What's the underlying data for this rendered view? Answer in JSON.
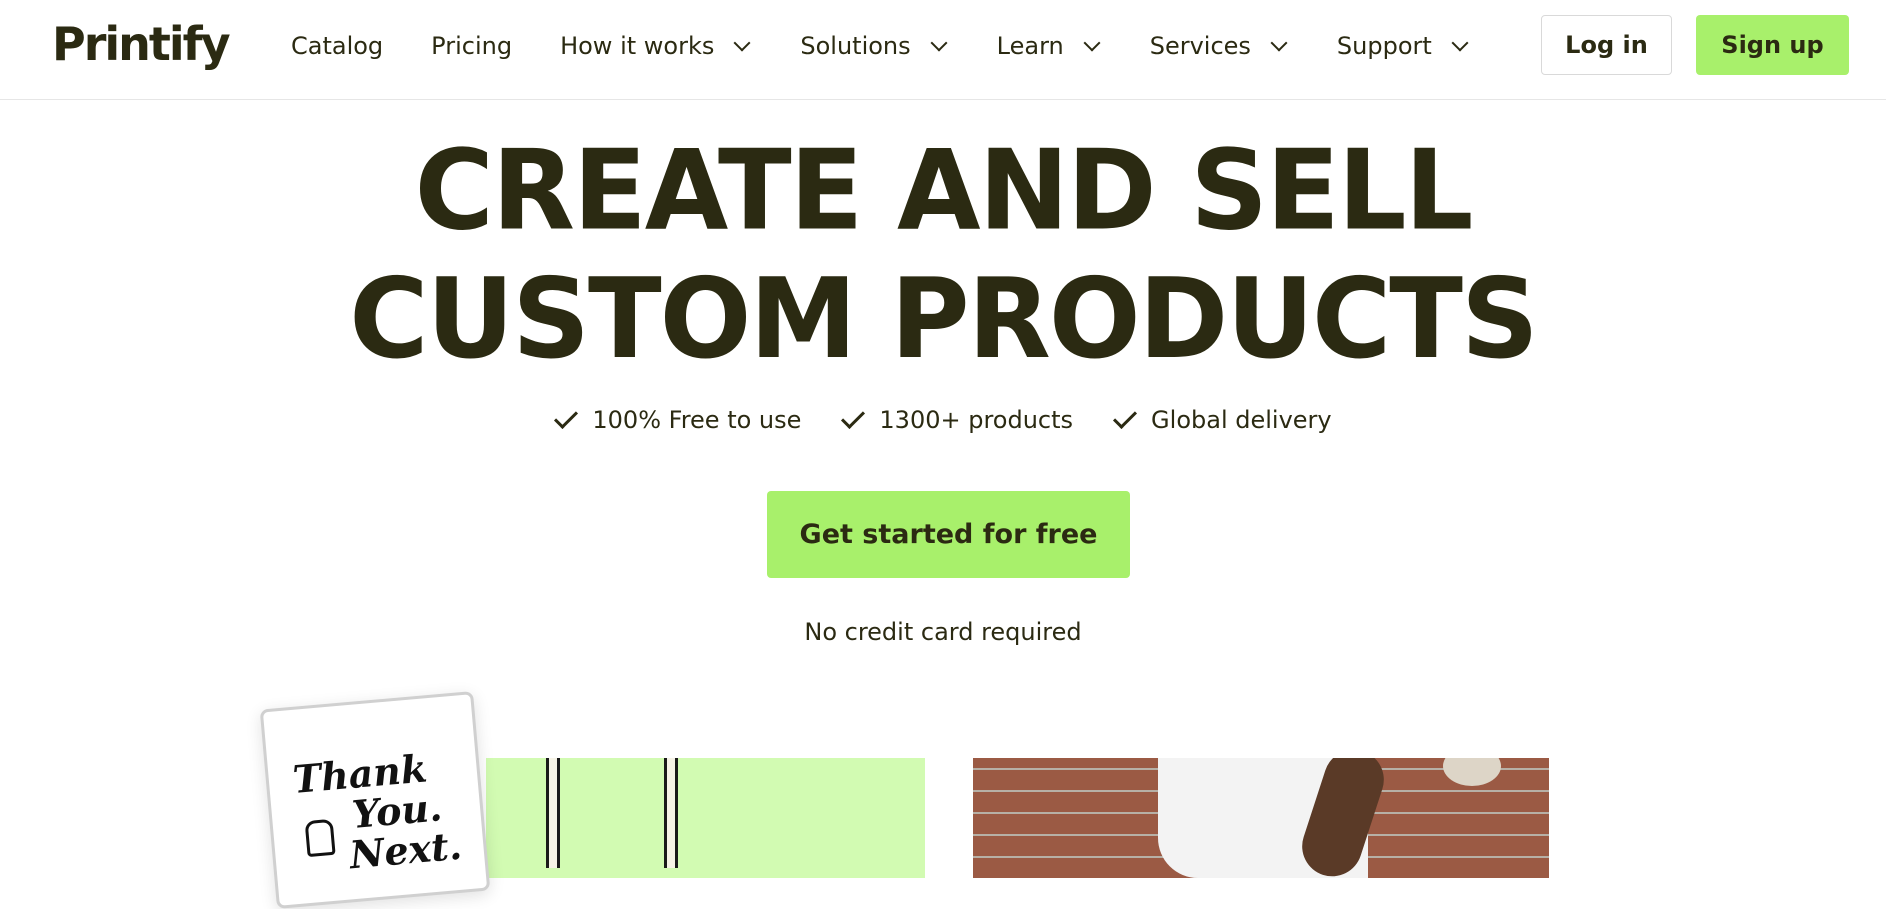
{
  "brand": {
    "logo_text": "Printify",
    "accent": "#a8f06b",
    "text_color": "#2b2a12"
  },
  "nav": {
    "items": [
      {
        "label": "Catalog",
        "has_dropdown": false
      },
      {
        "label": "Pricing",
        "has_dropdown": false
      },
      {
        "label": "How it works",
        "has_dropdown": true
      },
      {
        "label": "Solutions",
        "has_dropdown": true
      },
      {
        "label": "Learn",
        "has_dropdown": true
      },
      {
        "label": "Services",
        "has_dropdown": true
      },
      {
        "label": "Support",
        "has_dropdown": true
      }
    ],
    "login_label": "Log in",
    "signup_label": "Sign up"
  },
  "hero": {
    "title_line1": "CREATE AND SELL",
    "title_line2": "CUSTOM PRODUCTS",
    "features": [
      "100% Free to use",
      "1300+ products",
      "Global delivery"
    ],
    "cta_label": "Get started for free",
    "note": "No credit card required"
  },
  "promo": {
    "card_line1": "Thank",
    "card_line2": "You.",
    "card_line3": "Next."
  }
}
